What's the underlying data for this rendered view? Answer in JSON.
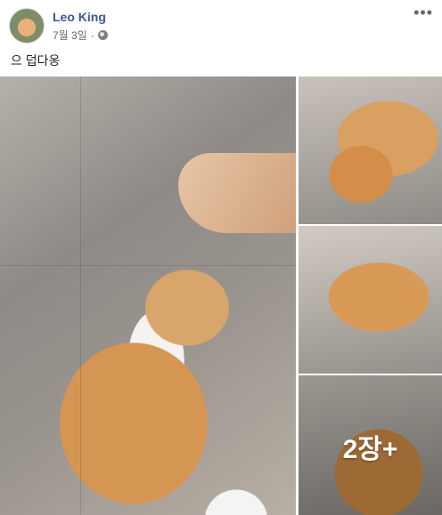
{
  "post": {
    "author": "Leo King",
    "date": "7월 3일",
    "privacy_icon": "globe-icon",
    "more_label": "•••",
    "text": "으 덥다옹"
  },
  "photos": {
    "extra_count_label": "2장+"
  }
}
